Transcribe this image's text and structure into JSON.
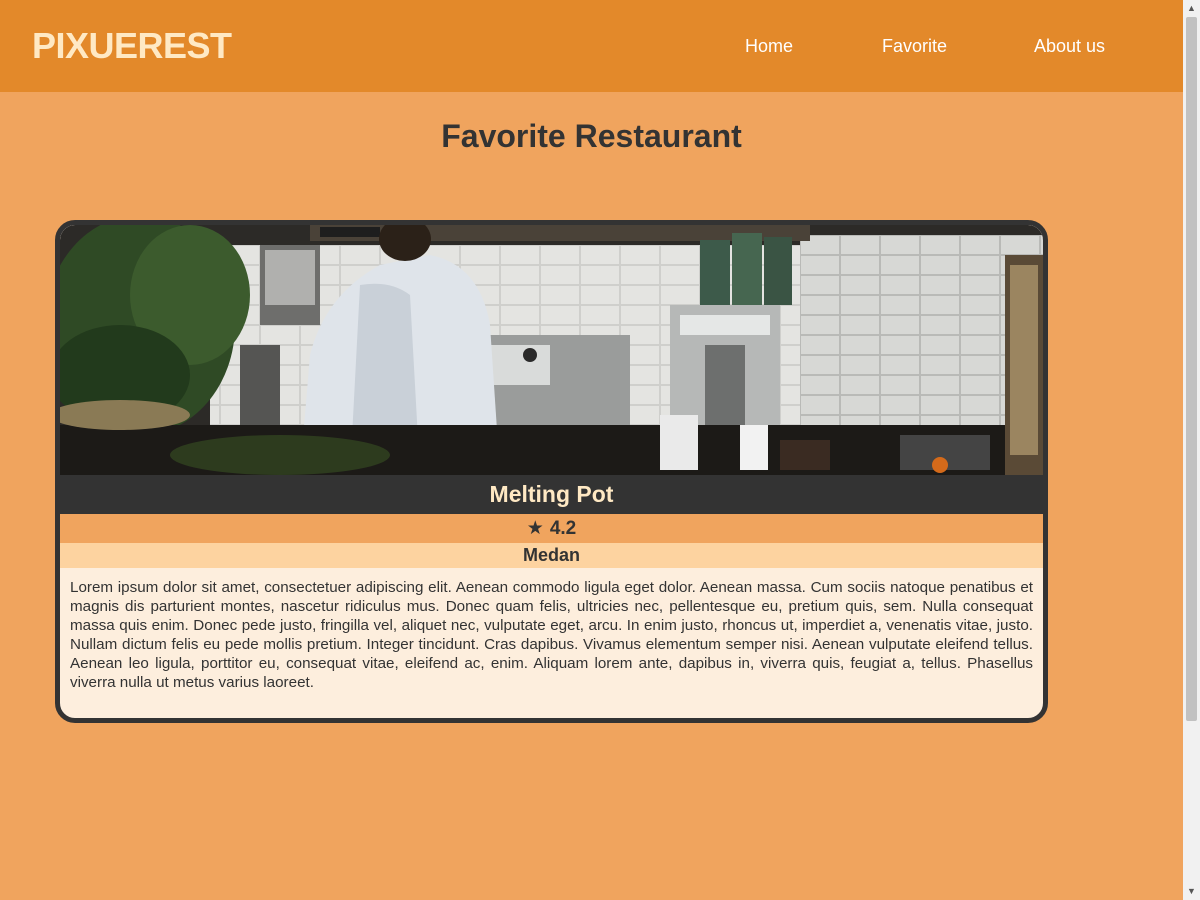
{
  "header": {
    "logo": "PIXUEREST",
    "nav": {
      "home": "Home",
      "favorite": "Favorite",
      "about": "About us"
    }
  },
  "main": {
    "title": "Favorite Restaurant",
    "restaurants": [
      {
        "name": "Melting Pot",
        "rating": "4.2",
        "star_icon": "★",
        "city": "Medan",
        "description": "Lorem ipsum dolor sit amet, consectetuer adipiscing elit. Aenean commodo ligula eget dolor. Aenean massa. Cum sociis natoque penatibus et magnis dis parturient montes, nascetur ridiculus mus. Donec quam felis, ultricies nec, pellentesque eu, pretium quis, sem. Nulla consequat massa quis enim. Donec pede justo, fringilla vel, aliquet nec, vulputate eget, arcu. In enim justo, rhoncus ut, imperdiet a, venenatis vitae, justo. Nullam dictum felis eu pede mollis pretium. Integer tincidunt. Cras dapibus. Vivamus elementum semper nisi. Aenean vulputate eleifend tellus. Aenean leo ligula, porttitor eu, consequat vitae, eleifend ac, enim. Aliquam lorem ante, dapibus in, viverra quis, feugiat a, tellus. Phasellus viverra nulla ut metus varius laoreet."
      }
    ]
  },
  "colors": {
    "header_bg": "#e3892a",
    "page_bg": "#f0a45e",
    "logo": "#ffe9c4",
    "card_border": "#333333",
    "card_body": "#fdeedd",
    "city_bg": "#fdd3a0"
  },
  "scrollbar": {
    "up_icon": "▲",
    "down_icon": "▼"
  }
}
